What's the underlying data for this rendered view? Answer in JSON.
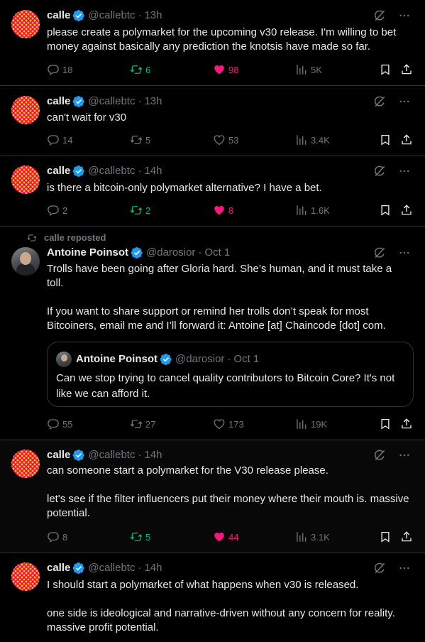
{
  "colors": {
    "accent_blue": "#1d9bf0",
    "green_repost": "#00ba7c",
    "pink_like": "#f91880",
    "muted": "#71767b",
    "border": "#2f3336"
  },
  "tweets": [
    {
      "name": "calle",
      "handle": "@callebtc",
      "time": "13h",
      "text": "please create a polymarket for the upcoming v30 release. I'm willing to bet money against basically any prediction the knotsis have made so far.",
      "replies": "18",
      "reposts": "6",
      "likes": "98",
      "views": "5K",
      "reposted": true,
      "liked": true
    },
    {
      "name": "calle",
      "handle": "@callebtc",
      "time": "13h",
      "text": "can't wait for v30",
      "replies": "14",
      "reposts": "5",
      "likes": "53",
      "views": "3.4K",
      "reposted": false,
      "liked": false
    },
    {
      "name": "calle",
      "handle": "@callebtc",
      "time": "14h",
      "text": "is there a bitcoin-only polymarket alternative? I have a bet.",
      "replies": "2",
      "reposts": "2",
      "likes": "8",
      "views": "1.6K",
      "reposted": true,
      "liked": true
    },
    {
      "repost_label": "calle reposted",
      "name": "Antoine Poinsot",
      "handle": "@darosior",
      "time": "Oct 1",
      "text": "Trolls have been going after Gloria hard. She’s human, and it must take a toll.\n\nIf you want to share support or remind her trolls don’t speak for most Bitcoiners, email me and I’ll forward it: Antoine [at] Chaincode [dot] com.",
      "quote": {
        "name": "Antoine Poinsot",
        "handle": "@darosior",
        "time": "Oct 1",
        "text": "Can we stop trying to cancel quality contributors to Bitcoin Core? It's not like we can afford it."
      },
      "replies": "55",
      "reposts": "27",
      "likes": "173",
      "views": "19K",
      "reposted": false,
      "liked": false
    },
    {
      "name": "calle",
      "handle": "@callebtc",
      "time": "14h",
      "text": "can someone start a polymarket for the V30 release please.\n\nlet's see if the filter influencers put their money where their mouth is. massive potential.",
      "replies": "8",
      "reposts": "5",
      "likes": "44",
      "views": "3.1K",
      "reposted": true,
      "liked": true
    },
    {
      "name": "calle",
      "handle": "@callebtc",
      "time": "14h",
      "text": "I should start a polymarket of what happens when v30 is released.\n\none side is ideological and narrative-driven without any concern for reality. massive profit potential."
    }
  ],
  "icons": [
    "reply-icon",
    "repost-icon",
    "like-icon",
    "views-icon",
    "bookmark-icon",
    "share-icon",
    "grok-icon",
    "more-icon",
    "verified-icon"
  ]
}
